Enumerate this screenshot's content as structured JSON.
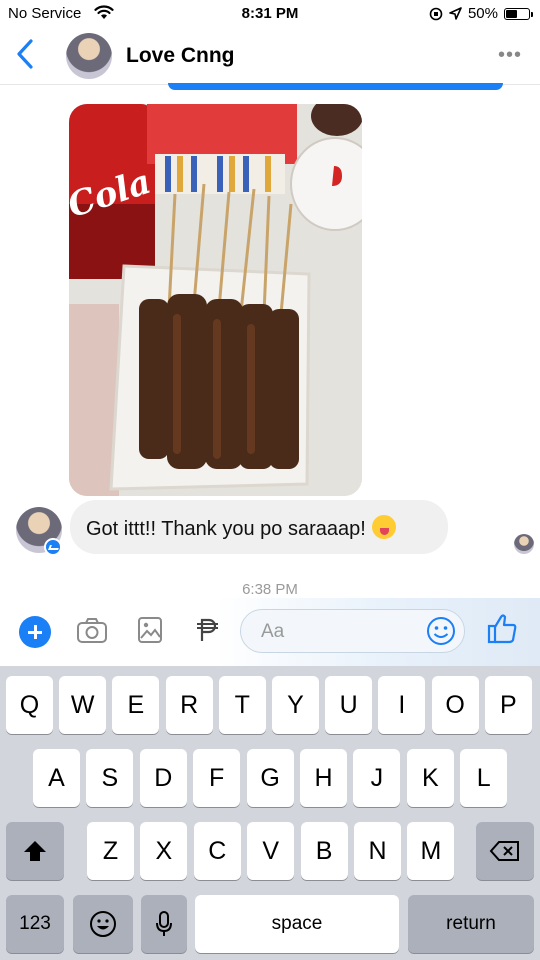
{
  "status_bar": {
    "carrier": "No Service",
    "time": "8:31 PM",
    "battery": "50%",
    "battery_level": 0.5
  },
  "header": {
    "contact_name": "Love Cnng",
    "more_label": "•••"
  },
  "conversation": {
    "message_text": "Got ittt!! Thank you po saraaap!",
    "timestamp": "6:38 PM",
    "photo_visible_text": "Cola"
  },
  "composer": {
    "placeholder": "Aa",
    "value": ""
  },
  "keyboard": {
    "row1": [
      "Q",
      "W",
      "E",
      "R",
      "T",
      "Y",
      "U",
      "I",
      "O",
      "P"
    ],
    "row2": [
      "A",
      "S",
      "D",
      "F",
      "G",
      "H",
      "J",
      "K",
      "L"
    ],
    "row3": [
      "Z",
      "X",
      "C",
      "V",
      "B",
      "N",
      "M"
    ],
    "numbers_label": "123",
    "space_label": "space",
    "return_label": "return"
  },
  "colors": {
    "accent": "#1b7ff5",
    "bubble": "#f0f0f0",
    "keyboard_bg": "#d2d6dc",
    "dark_key": "#abb0ba"
  }
}
